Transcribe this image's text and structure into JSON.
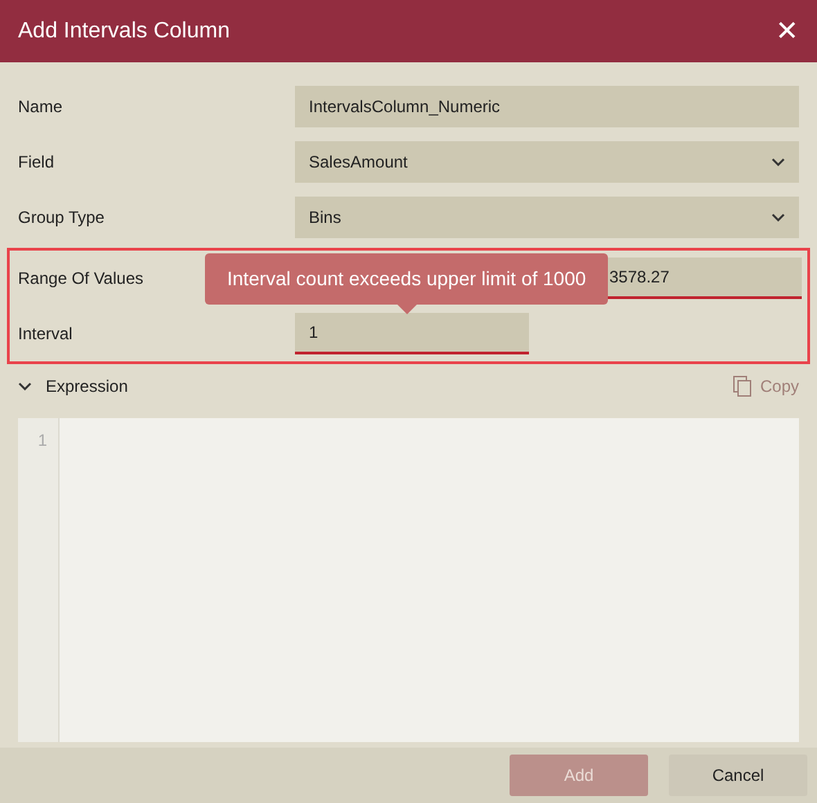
{
  "window": {
    "title": "Add Intervals Column",
    "close_glyph": "✕"
  },
  "fields": [
    {
      "kind": "text",
      "label": "Name",
      "value": "IntervalsColumn_Numeric",
      "invalid": false
    },
    {
      "kind": "select",
      "label": "Field",
      "value": "SalesAmount",
      "invalid": false
    },
    {
      "kind": "select",
      "label": "Group Type",
      "value": "Bins",
      "invalid": false
    },
    {
      "kind": "range",
      "label": "Range Of Values",
      "to_value": "3578.27",
      "invalid": true
    },
    {
      "kind": "short",
      "label": "Interval",
      "value": "1",
      "invalid": true
    }
  ],
  "error_tooltip": "Interval count exceeds upper limit of 1000",
  "expression": {
    "label": "Expression",
    "expanded": true,
    "copy_label": "Copy",
    "copy_disabled": true,
    "line_numbers": [
      "1"
    ]
  },
  "buttons": [
    {
      "label": "Add",
      "disabled": true
    },
    {
      "label": "Cancel",
      "disabled": false
    }
  ]
}
